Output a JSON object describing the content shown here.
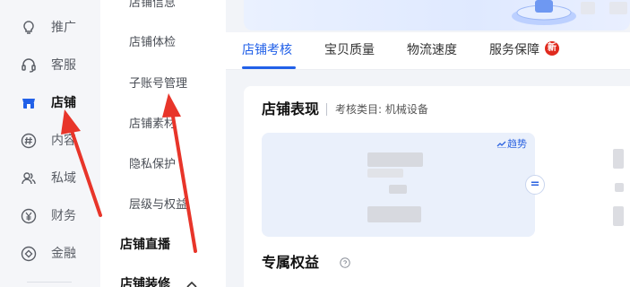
{
  "sidebar": {
    "items": [
      {
        "label": "推广",
        "icon": "lightbulb-icon"
      },
      {
        "label": "客服",
        "icon": "headset-icon"
      },
      {
        "label": "店铺",
        "icon": "store-icon"
      },
      {
        "label": "内容",
        "icon": "hashtag-icon"
      },
      {
        "label": "私域",
        "icon": "users-icon"
      },
      {
        "label": "财务",
        "icon": "yen-icon"
      },
      {
        "label": "金融",
        "icon": "coin-icon"
      }
    ],
    "active_index": 2
  },
  "submenu": {
    "items": [
      "店铺信息",
      "店铺体检",
      "子账号管理",
      "店铺素材",
      "隐私保护",
      "层级与权益"
    ],
    "groups": [
      "店铺直播",
      "店铺装修"
    ]
  },
  "tabs": {
    "items": [
      "店铺考核",
      "宝贝质量",
      "物流速度",
      "服务保障"
    ],
    "active_index": 0,
    "badge": "新"
  },
  "card": {
    "title": "店铺表现",
    "subtitle": "考核类目: 机械设备",
    "trend_label": "趋势",
    "equals": "=",
    "perk_title": "专属权益"
  },
  "colors": {
    "accent": "#2160e8",
    "badge": "#e02a1e",
    "annotation": "#e8352a"
  }
}
